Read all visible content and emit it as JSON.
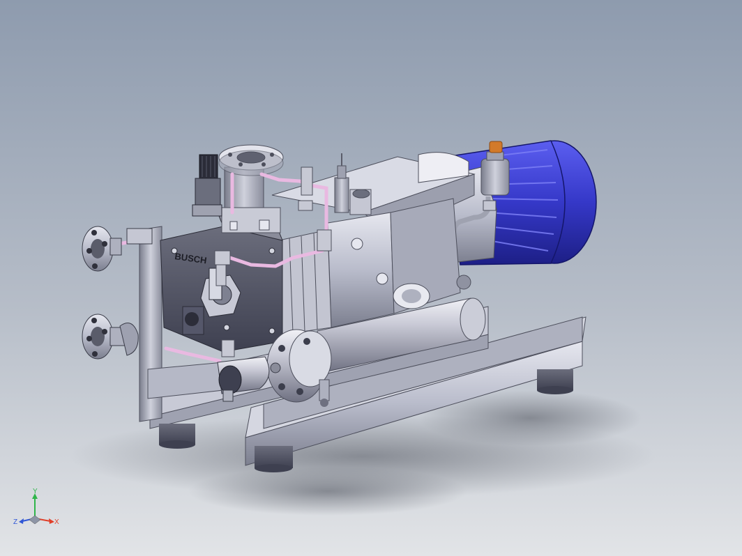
{
  "viewport": {
    "background_top": "#8e9bae",
    "background_bottom": "#dfe2e5"
  },
  "model": {
    "logo_text": "BUSCH",
    "colors": {
      "steel": "#b9bccb",
      "steel_dark": "#5d5f6e",
      "steel_light": "#e4e5ee",
      "motor_blue": "#3538c8",
      "motor_blue_dark": "#1d1f86",
      "pipe_pink": "#e9b9e1",
      "orange_cap": "#d27a2a"
    }
  },
  "triad": {
    "x_label": "X",
    "y_label": "Y",
    "z_label": "Z",
    "x_color": "#e0402a",
    "y_color": "#2fb54a",
    "z_color": "#2f56d6"
  }
}
